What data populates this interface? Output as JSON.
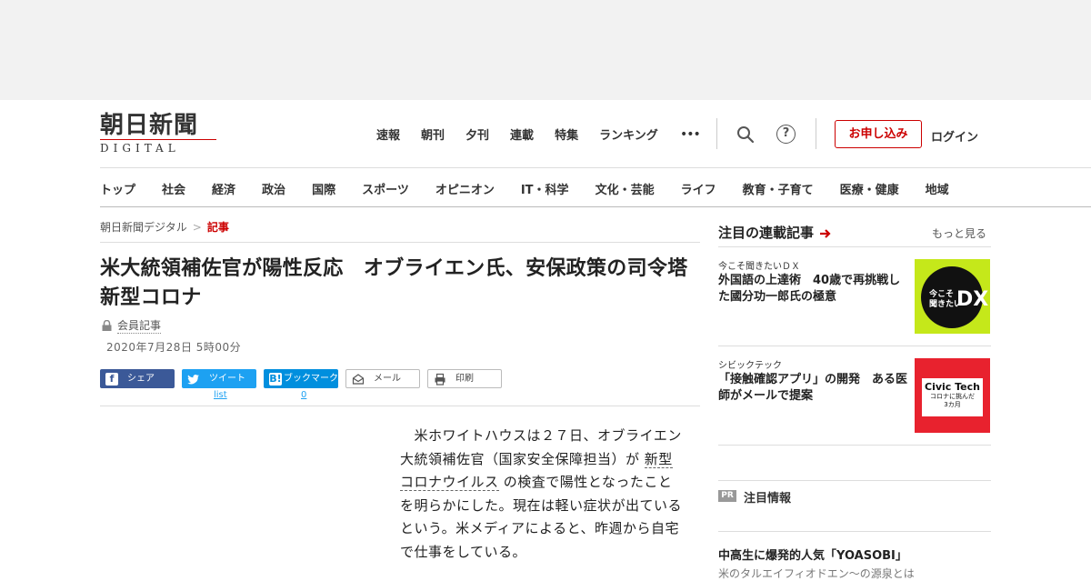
{
  "logo": {
    "main": "朝日新聞",
    "sub": "DIGITAL"
  },
  "topnav": [
    "速報",
    "朝刊",
    "夕刊",
    "連載",
    "特集",
    "ランキング"
  ],
  "header_actions": {
    "more": "•••",
    "help": "?",
    "apply": "お申し込み",
    "login": "ログイン"
  },
  "catnav": [
    "トップ",
    "社会",
    "経済",
    "政治",
    "国際",
    "スポーツ",
    "オピニオン",
    "IT・科学",
    "文化・芸能",
    "ライフ",
    "教育・子育て",
    "医療・健康",
    "地域"
  ],
  "breadcrumb": {
    "home": "朝日新聞デジタル",
    "sep": ">",
    "current": "記事"
  },
  "article": {
    "title": "米大統領補佐官が陽性反応　オブライエン氏、安保政策の司令塔　新型コロナ",
    "member": "会員記事",
    "date": "2020年7月28日 5時00分",
    "body_1": "　米ホワイトハウスは２７日、オブライエン大統領補佐官（国家安全保障担当）が",
    "body_kw": "新型コロナウイルス",
    "body_2": "の検査で陽性となったことを明らかにした。現在は軽い症状が出ているという。米メディアによると、昨週から自宅で仕事をしている。"
  },
  "share": {
    "facebook": "シェア",
    "twitter": "ツイート",
    "hatena": "ブックマーク",
    "mail": "メール",
    "print": "印刷",
    "twitter_count": "list",
    "hatena_count": "0"
  },
  "sidebar": {
    "heading": "注目の連載記事",
    "more": "もっと見る",
    "items": [
      {
        "kicker": "今こそ聞きたいＤＸ",
        "title": "外国語の上達術　40歳で再挑戦した國分功一郎氏の極意",
        "thumb_text_1": "今こそ\n聞きたい",
        "thumb_text_2": "DX"
      },
      {
        "kicker": "シビックテック",
        "title": "「接触確認アプリ」の開発　ある医師がメールで提案",
        "thumb_text_1": "Civic Tech",
        "thumb_text_2": "コロナに挑んだ\n3カ月"
      }
    ],
    "pr_badge": "PR",
    "pr_label": "注目情報",
    "pr_title": "中高生に爆発的人気「YOASOBI」",
    "pr_sub": "米のタルエイフィオドエン～の源泉とは"
  },
  "colors": {
    "brand_red": "#cc0000",
    "facebook": "#3b5998",
    "twitter": "#1da1f2",
    "hatena": "#008fde"
  }
}
